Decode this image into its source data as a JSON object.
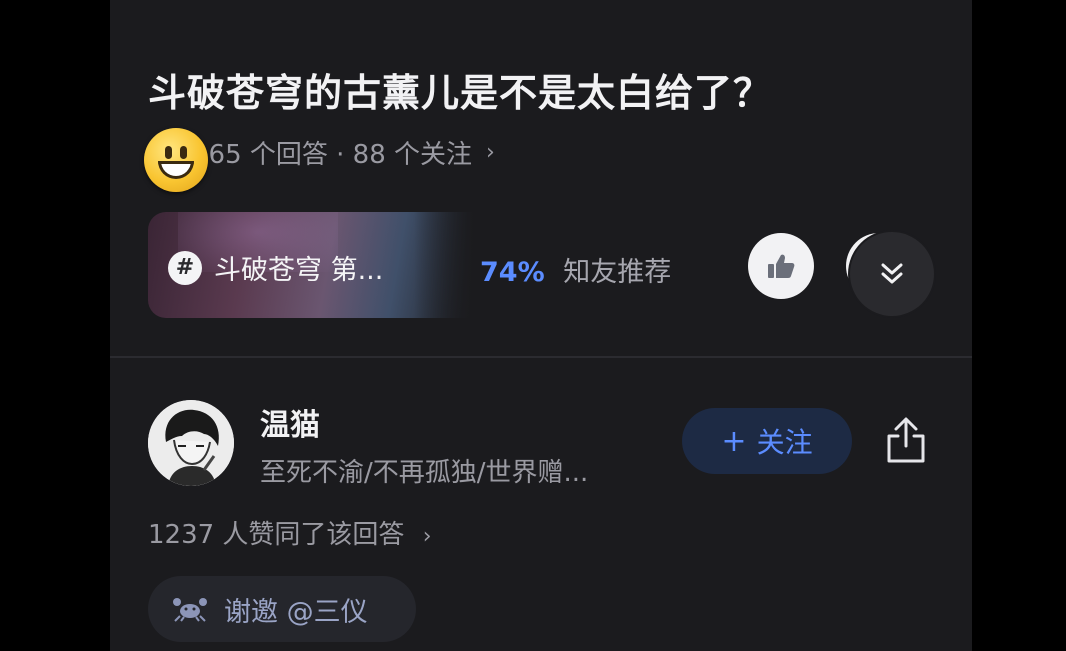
{
  "question": {
    "title": "斗破苍穹的古薰儿是不是太白给了？",
    "meta": "· 65 个回答 · 88 个关注",
    "meta_chevron": "›"
  },
  "topic": {
    "label": "斗破苍穹 第...",
    "recommend_pct": "74%",
    "recommend_text": "知友推荐"
  },
  "answer": {
    "author_name": "温猫",
    "author_bio": "至死不渝/不再孤独/世界赠...",
    "follow_label": "关注",
    "follow_plus": "+",
    "votes_text": "1237 人赞同了该回答",
    "votes_chevron": "›",
    "thanks_text": "谢邀 @三仪"
  },
  "icons": {
    "emoji": "grinning-face-icon",
    "hash": "hashtag-icon",
    "like": "thumbs-up-icon",
    "expand": "double-chevron-down-icon",
    "share": "share-icon",
    "crab": "crab-icon"
  },
  "colors": {
    "background": "#1b1b1e",
    "accent": "#5b8cff",
    "muted_text": "#9a9aa2"
  }
}
